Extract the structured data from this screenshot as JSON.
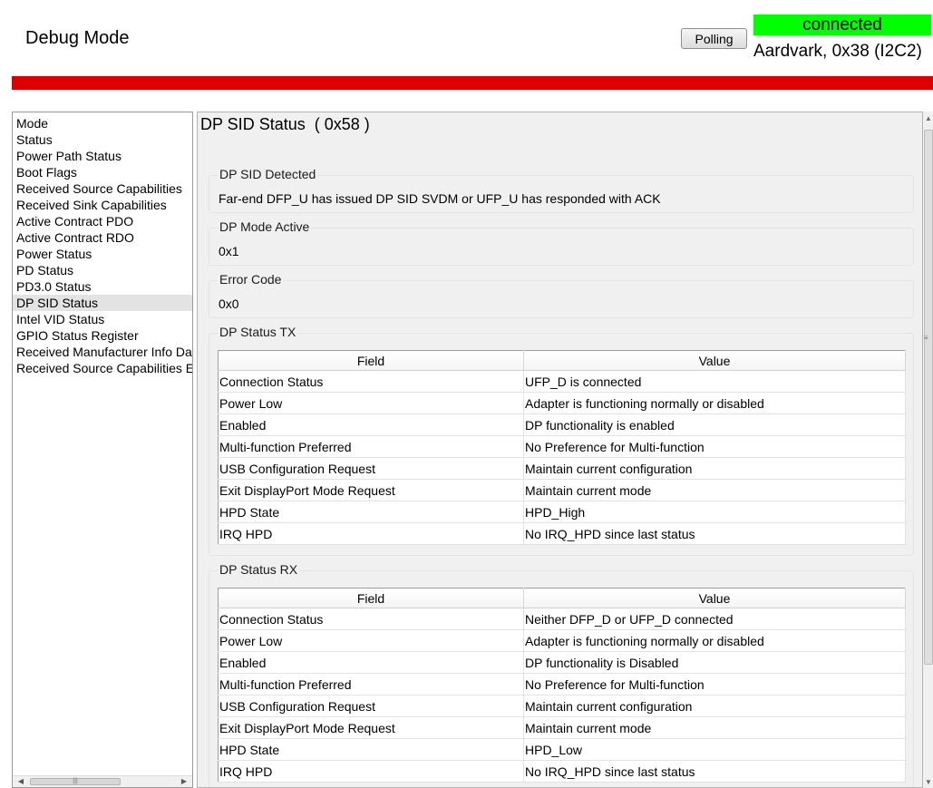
{
  "app": {
    "title": "Debug Mode"
  },
  "header": {
    "polling_label": "Polling",
    "connection_status": "connected",
    "connection_info": "Aardvark, 0x38 (I2C2)",
    "status_color": "#00ff00",
    "accent_bar_color": "#dd0000"
  },
  "sidebar": {
    "items": [
      {
        "label": "Mode"
      },
      {
        "label": "Status"
      },
      {
        "label": "Power Path Status"
      },
      {
        "label": "Boot Flags"
      },
      {
        "label": "Received Source Capabilities"
      },
      {
        "label": "Received Sink Capabilities"
      },
      {
        "label": "Active Contract PDO"
      },
      {
        "label": "Active Contract RDO"
      },
      {
        "label": "Power Status"
      },
      {
        "label": "PD Status"
      },
      {
        "label": "PD3.0 Status"
      },
      {
        "label": "DP SID Status"
      },
      {
        "label": "Intel VID Status"
      },
      {
        "label": "GPIO Status Register"
      },
      {
        "label": "Received Manufacturer Info Da"
      },
      {
        "label": "Received Source Capabilities E"
      }
    ],
    "selected": "DP SID Status"
  },
  "main": {
    "title": "DP SID Status  ( 0x58 )",
    "dp_sid_detected": {
      "label": "DP SID Detected",
      "value": "Far-end DFP_U has issued DP SID SVDM or UFP_U has responded with ACK"
    },
    "dp_mode_active": {
      "label": "DP Mode Active",
      "value": "0x1"
    },
    "error_code": {
      "label": "Error Code",
      "value": "0x0"
    },
    "dp_status_tx": {
      "label": "DP Status TX",
      "columns": [
        "Field",
        "Value"
      ],
      "rows": [
        [
          "Connection Status",
          "UFP_D is connected"
        ],
        [
          "Power Low",
          "Adapter is functioning normally or disabled"
        ],
        [
          "Enabled",
          "DP functionality is enabled"
        ],
        [
          "Multi-function Preferred",
          "No Preference for Multi-function"
        ],
        [
          "USB Configuration Request",
          "Maintain current configuration"
        ],
        [
          "Exit DisplayPort Mode Request",
          "Maintain current mode"
        ],
        [
          "HPD State",
          "HPD_High"
        ],
        [
          "IRQ HPD",
          "No IRQ_HPD since last status"
        ]
      ]
    },
    "dp_status_rx": {
      "label": "DP Status RX",
      "columns": [
        "Field",
        "Value"
      ],
      "rows": [
        [
          "Connection Status",
          "Neither DFP_D or UFP_D connected"
        ],
        [
          "Power Low",
          "Adapter is functioning normally or disabled"
        ],
        [
          "Enabled",
          "DP functionality is Disabled"
        ],
        [
          "Multi-function Preferred",
          "No Preference for Multi-function"
        ],
        [
          "USB Configuration Request",
          "Maintain current configuration"
        ],
        [
          "Exit DisplayPort Mode Request",
          "Maintain current mode"
        ],
        [
          "HPD State",
          "HPD_Low"
        ],
        [
          "IRQ HPD",
          "No IRQ_HPD since last status"
        ]
      ]
    }
  }
}
